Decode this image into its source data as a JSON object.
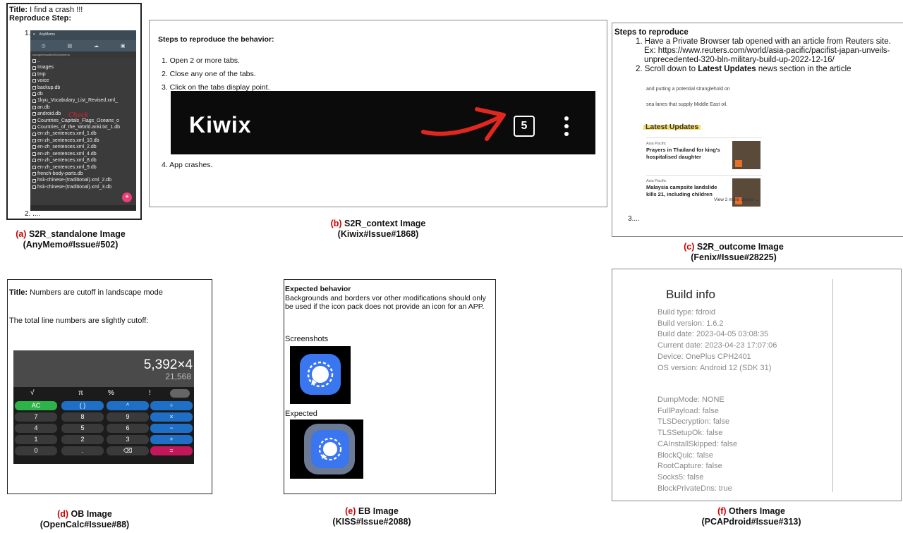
{
  "panels": {
    "a": {
      "title_label": "Title:",
      "title_value": " I find a crash !!!",
      "steps_heading": "Reproduce Step:",
      "step1": "1.",
      "step2": "2. ....",
      "app_name": "AnyMemo",
      "path": "storage/emulated/0/anymemo",
      "handwritten_note": "Check",
      "files": [
        "..",
        "Images",
        "tmp",
        "voice",
        "backup.db",
        "db",
        "1kyu_Vocabulary_List_Revised.xml_",
        "an.db",
        "android.db",
        "Countries_Capitals_Flags_Oceans_o",
        "Countries_of_the_World.anki.txt_1.db",
        "en-zh_sentences.xml_1.db",
        "en-zh_sentences.xml_10.db",
        "en-zh_sentences.xml_2.db",
        "en-zh_sentences.xml_4.db",
        "en-zh_sentences.xml_8.db",
        "en-zh_sentences.xml_9.db",
        "french-body-parts.db",
        "hsk-chinese-(traditional).xml_2.db",
        "hsk-chinese-(traditional).xml_3.db"
      ],
      "caption_letter": "(a)",
      "caption_line1": " S2R_standalone Image",
      "caption_line2": "(AnyMemo#Issue#502)"
    },
    "b": {
      "heading": "Steps to reproduce the behavior:",
      "steps": [
        "1. Open 2 or more tabs.",
        "2. Close any one of the tabs.",
        "3. Click on the tabs display point."
      ],
      "step4": "4. App crashes.",
      "logo": "Kiwix",
      "tab_count": "5",
      "caption_letter": "(b)",
      "caption_line1": " S2R_context Image",
      "caption_line2": "(Kiwix#Issue#1868)"
    },
    "c": {
      "heading": "Steps to reproduce",
      "step1": "1. Have a Private Browser tab opened with an article from Reuters site. Ex: https://www.reuters.com/world/asia-pacific/pacifist-japan-unveils-unprecedented-320-bln-military-build-up-2022-12-16/",
      "step2_prefix": "2. Scroll down to ",
      "step2_bold": "Latest Updates",
      "step2_suffix": " news section in the article",
      "snippet1": "and putting a potential stranglehold on",
      "snippet2": "sea lanes that supply Middle East oil.",
      "latest_updates": "Latest Updates",
      "news": [
        {
          "category": "Asia Pacific",
          "headline": "Prayers in Thailand for king's hospitalised daughter"
        },
        {
          "category": "Asia Pacific",
          "headline": "Malaysia campsite landslide kills 21, including children"
        }
      ],
      "more": "View 2 more stories ⌄",
      "step3": "3....",
      "caption_letter": "(c)",
      "caption_line1": " S2R_outcome Image",
      "caption_line2": "(Fenix#Issue#28225)"
    },
    "d": {
      "title_label": "Title:",
      "title_value": " Numbers are cutoff in landscape mode",
      "desc": "The total line numbers are slightly cutoff:",
      "display_main": "5,392×4",
      "display_result": "21,568",
      "fn_keys": [
        "√",
        "π",
        "%",
        "!"
      ],
      "keys": [
        "AC",
        "( )",
        "^",
        "÷",
        "7",
        "8",
        "9",
        "×",
        "4",
        "5",
        "6",
        "−",
        "1",
        "2",
        "3",
        "+",
        "0",
        ".",
        "⌫",
        "="
      ],
      "caption_letter": "(d)",
      "caption_line1": " OB Image",
      "caption_line2": "(OpenCalc#Issue#88)"
    },
    "e": {
      "heading": "Expected behavior",
      "text": "Backgrounds and borders vor other modifications should only be used if the icon pack does not provide an icon for an APP.",
      "screenshots": "Screenshots",
      "expected": "Expected",
      "caption_letter": "(e)",
      "caption_line1": " EB Image",
      "caption_line2": "(KISS#Issue#2088)"
    },
    "f": {
      "heading": "Build info",
      "lines1": [
        "Build type: fdroid",
        "Build version: 1.6.2",
        "Build date: 2023-04-05 03:08:35",
        "Current date: 2023-04-23 17:07:06",
        "Device: OnePlus CPH2401",
        "OS version: Android 12 (SDK 31)"
      ],
      "lines2": [
        "DumpMode: NONE",
        "FullPayload: false",
        "TLSDecryption: false",
        "TLSSetupOk: false",
        "CAInstallSkipped: false",
        "BlockQuic: false",
        "RootCapture: false",
        "Socks5: false",
        "BlockPrivateDns: true"
      ],
      "caption_letter": "(f)",
      "caption_line1": " Others Image",
      "caption_line2": "(PCAPdroid#Issue#313)"
    }
  },
  "colors": {
    "caption_letter": "#cc0000",
    "calc_green": "#2db34a",
    "calc_blue": "#1e6fc5",
    "calc_pink": "#c2185b",
    "signal_blue": "#3a76f0"
  }
}
